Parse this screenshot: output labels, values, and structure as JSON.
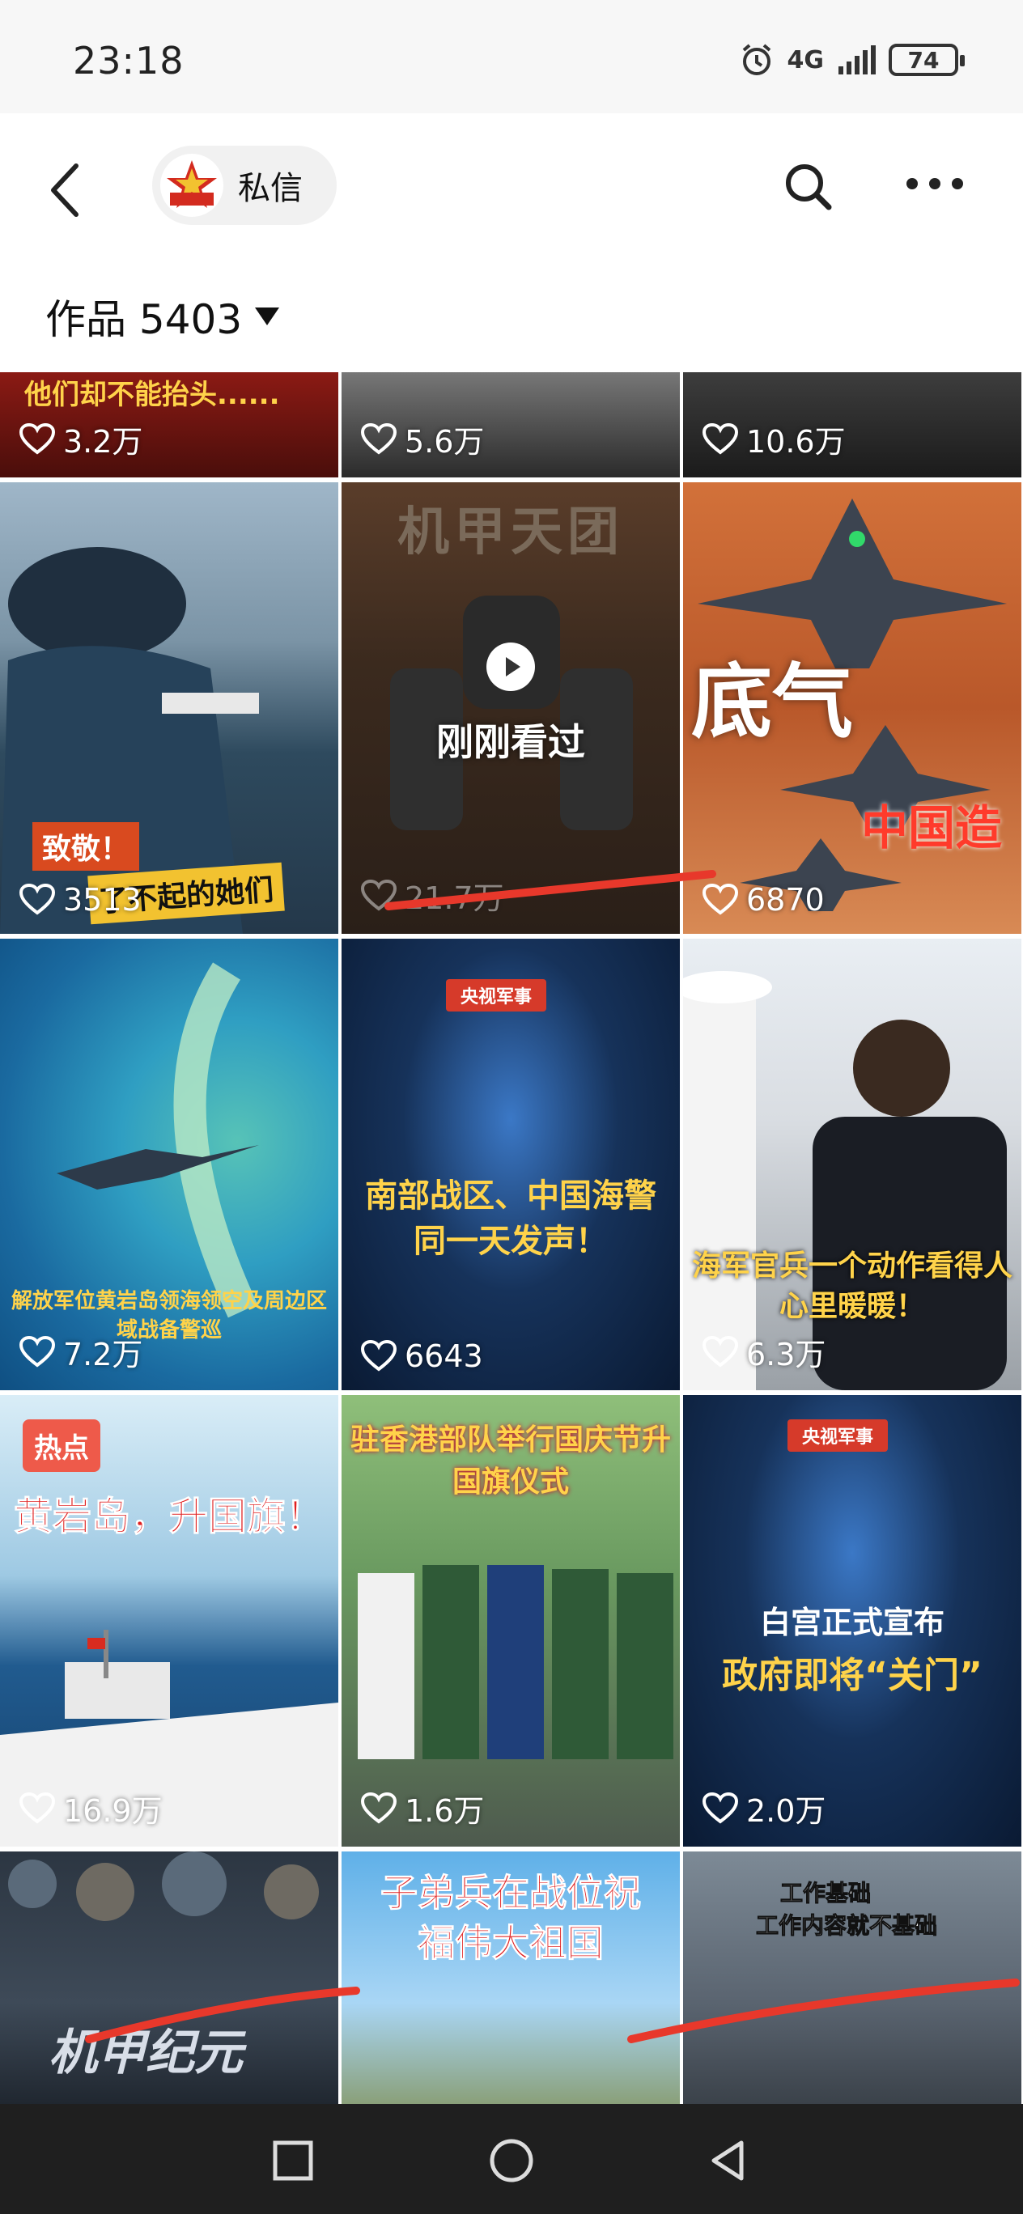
{
  "status": {
    "time": "23:18",
    "signal": "4G",
    "battery": "74"
  },
  "header": {
    "chip_label": "私信",
    "avatar_badge": "央视军事"
  },
  "works": {
    "label": "作品 5403"
  },
  "tiles": [
    {
      "likes": "3.2万",
      "caption": "他们却不能抬头......"
    },
    {
      "likes": "5.6万"
    },
    {
      "likes": "10.6万"
    },
    {
      "likes": "3513",
      "caption_a": "致敬！",
      "caption_b": "了不起的她们"
    },
    {
      "likes": "21.7万",
      "title": "机甲天团",
      "overlay": "刚刚看过"
    },
    {
      "likes": "6870",
      "caption_a": "底气",
      "caption_b": "中国造"
    },
    {
      "likes": "7.2万",
      "caption": "解放军位黄岩岛领海领空及周边区域战备警巡"
    },
    {
      "likes": "6643",
      "badge": "央视军事",
      "caption": "南部战区、中国海警同一天发声！"
    },
    {
      "likes": "6.3万",
      "caption": "海军官兵一个动作看得人心里暖暖！"
    },
    {
      "likes": "16.9万",
      "tag": "热点",
      "caption": "黄岩岛，升国旗！"
    },
    {
      "likes": "1.6万",
      "caption": "驻香港部队举行国庆节升国旗仪式"
    },
    {
      "likes": "2.0万",
      "badge": "央视军事",
      "caption_a": "白宫正式宣布",
      "caption_b": "政府即将“关门”"
    },
    {
      "caption": "机甲纪元"
    },
    {
      "caption": "子弟兵在战位祝福伟大祖国"
    },
    {
      "caption_a": "工作基础",
      "caption_b": "工作内容就不基础"
    }
  ],
  "colors": {
    "accent_red": "#e8382b",
    "text_dark": "#111111",
    "nav_bg": "#1f1f1f"
  }
}
